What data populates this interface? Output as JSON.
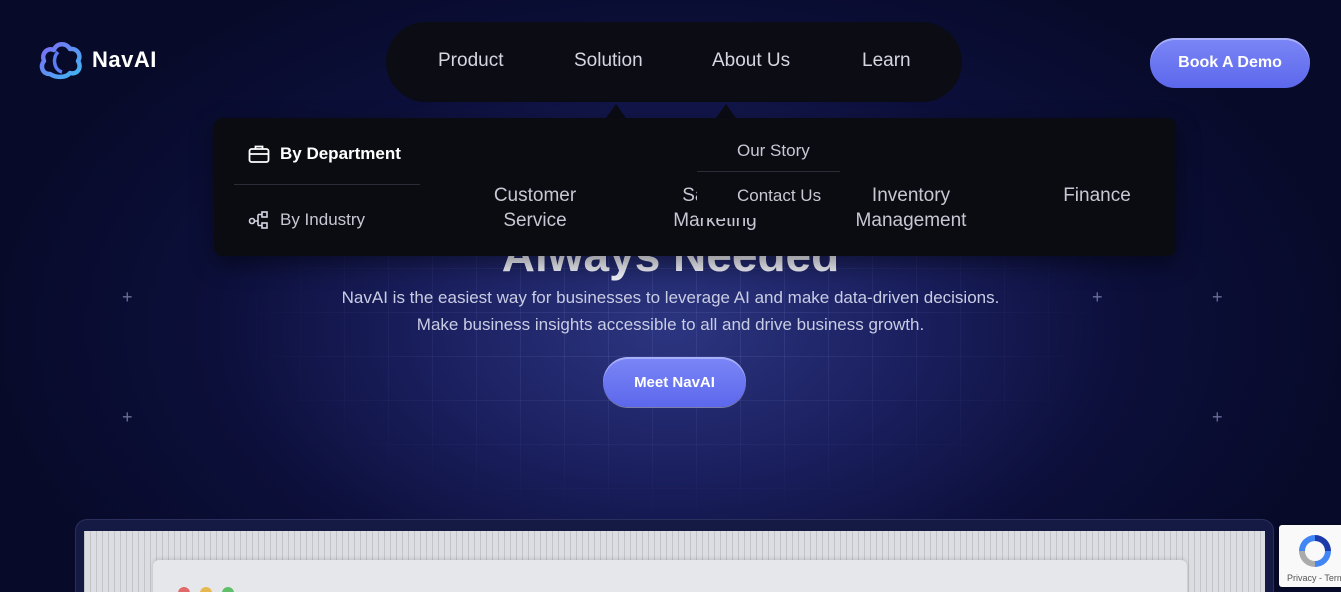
{
  "brand": {
    "name": "NavAI",
    "accent": "#6b77f2"
  },
  "nav": {
    "items": [
      {
        "label": "Product"
      },
      {
        "label": "Solution"
      },
      {
        "label": "About Us"
      },
      {
        "label": "Learn"
      }
    ],
    "cta_label": "Book A Demo"
  },
  "solution_menu": {
    "tabs": [
      {
        "label": "By Department",
        "icon": "briefcase-icon",
        "active": true
      },
      {
        "label": "By Industry",
        "icon": "hierarchy-icon",
        "active": false
      }
    ],
    "columns": [
      {
        "line1": "Customer",
        "line2": "Service"
      },
      {
        "line1": "Sales &",
        "line2": "Marketing"
      },
      {
        "line1": "Inventory",
        "line2": "Management"
      },
      {
        "line1": "Finance",
        "line2": ""
      }
    ]
  },
  "about_menu": {
    "items": [
      {
        "label": "Our Story"
      },
      {
        "label": "Contact Us"
      }
    ]
  },
  "hero": {
    "title": "Always Needed",
    "line1": "NavAI is the easiest way for businesses to leverage AI and make data-driven decisions.",
    "line2": "Make business insights accessible to all and drive business growth.",
    "cta_label": "Meet NavAI"
  },
  "recaptcha": {
    "terms": "Privacy - Terms"
  }
}
